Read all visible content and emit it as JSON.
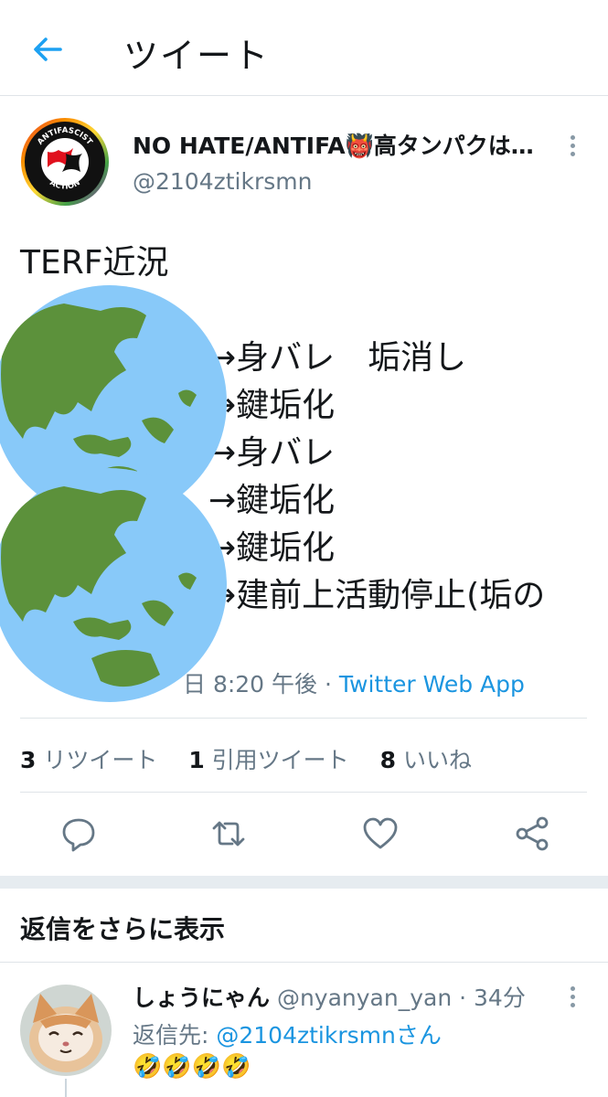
{
  "header": {
    "title": "ツイート"
  },
  "tweet": {
    "author_name": "NO HATE/ANTIFA👹高タンパクは…",
    "author_handle": "@2104ztikrsmn",
    "avatar_text_top": "ANTIFASCIST",
    "avatar_text_bottom": "ACTION",
    "text": "TERF近況",
    "chain": [
      "→身バレ　垢消し",
      "→鍵垢化",
      "→身バレ",
      "→鍵垢化",
      "→鍵垢化",
      "→建前上活動停止(垢の"
    ],
    "emoji": "earth-asia-globe",
    "time": "日 8:20 午後 · ",
    "via": "Twitter Web App"
  },
  "stats": {
    "retweets_count": "3",
    "retweets_label": " リツイート",
    "quotes_count": "1",
    "quotes_label": " 引用ツイート",
    "likes_count": "8",
    "likes_label": " いいね"
  },
  "actions": [
    "reply-icon",
    "retweet-icon",
    "like-icon",
    "share-icon"
  ],
  "more_replies": "返信をさらに表示",
  "reply": {
    "name": "しょうにゃん",
    "handle": " @nyanyan_yan · 34分",
    "reply_to_prefix": "返信先: ",
    "reply_to_mention": "@2104ztikrsmnさん",
    "text": "🤣🤣🤣🤣"
  },
  "colors": {
    "accent": "#1b95e0",
    "text": "#14171a",
    "muted": "#657786",
    "ocean": "#88c9f9",
    "land": "#5c913b"
  }
}
